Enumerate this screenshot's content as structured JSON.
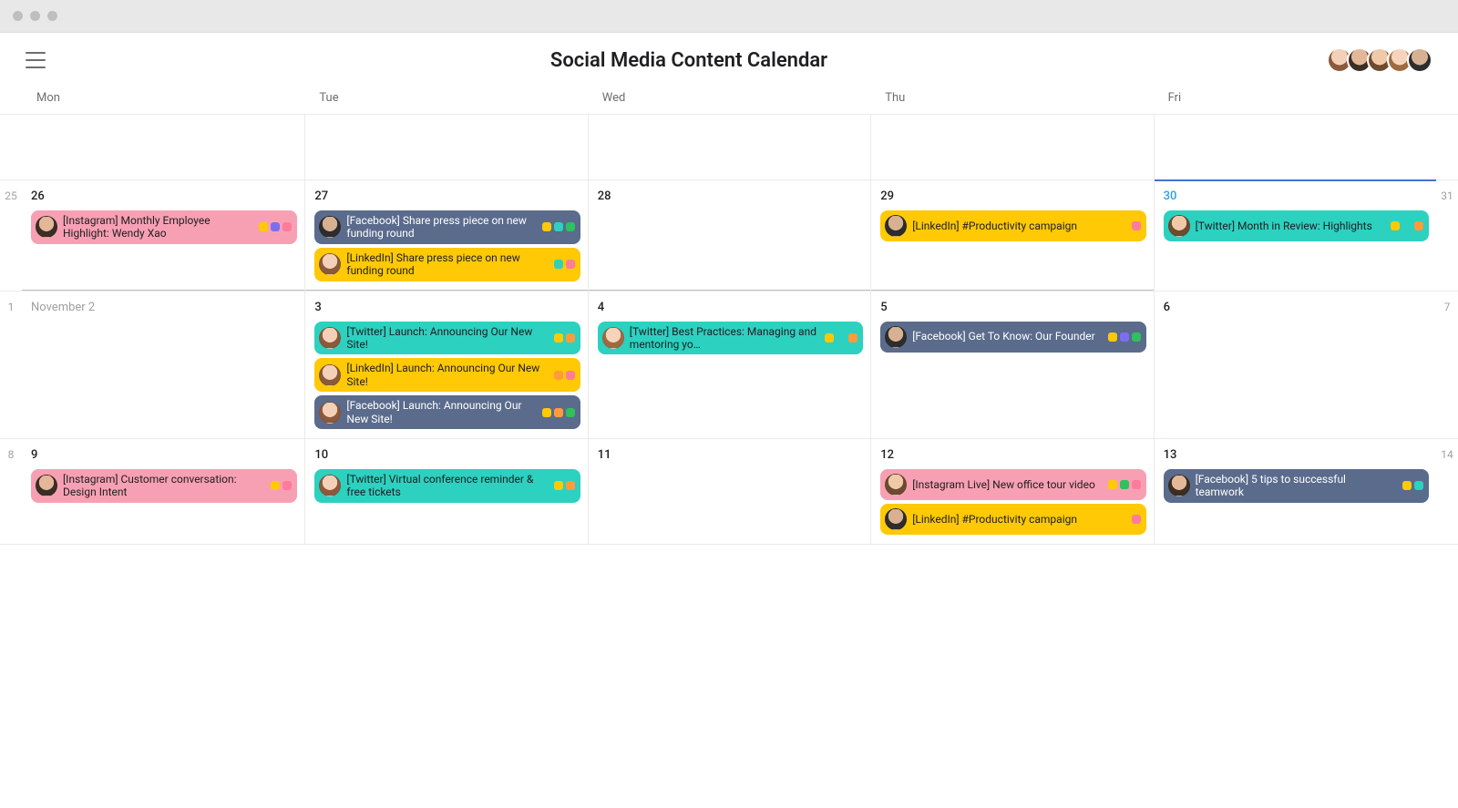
{
  "window": {
    "title": "Social Media Content Calendar"
  },
  "dow": [
    "Mon",
    "Tue",
    "Wed",
    "Thu",
    "Fri"
  ],
  "header_avatars": [
    "pA",
    "pB",
    "pC",
    "pD",
    "pE"
  ],
  "colors": {
    "event": {
      "pink": "#f8a0b3",
      "slate": "#5a6b8c",
      "yellow": "#ffc905",
      "teal": "#2cd1c0"
    },
    "tag": {
      "yellow": "#ffc905",
      "purple": "#7a6ff0",
      "pink": "#ff7b9d",
      "teal": "#2cd1c0",
      "green": "#2ec15d",
      "orange": "#ff9a3d",
      "blue": "#4aa3ff"
    }
  },
  "weeks": [
    {
      "left_gutter": "",
      "right_gutter": "",
      "stub": true,
      "cells": [
        {
          "label": "",
          "events": []
        },
        {
          "label": "",
          "events": []
        },
        {
          "label": "",
          "events": []
        },
        {
          "label": "",
          "events": []
        },
        {
          "label": "",
          "events": []
        }
      ]
    },
    {
      "left_gutter": "25",
      "right_gutter": "31",
      "cells": [
        {
          "label": "26",
          "month_edge": true,
          "events": [
            {
              "color": "pink",
              "avatar": "pB",
              "text": "[Instagram] Monthly Employee Highlight: Wendy Xao",
              "tags": [
                "yellow",
                "purple",
                "pink"
              ]
            }
          ]
        },
        {
          "label": "27",
          "month_edge": true,
          "events": [
            {
              "color": "slate",
              "avatar": "pE",
              "text": "[Facebook] Share press piece on new funding round",
              "tags": [
                "yellow",
                "teal",
                "green"
              ],
              "dark": true
            },
            {
              "color": "yellow",
              "avatar": "pA",
              "text": "[LinkedIn] Share press piece on new funding round",
              "tags": [
                "teal",
                "pink"
              ]
            }
          ]
        },
        {
          "label": "28",
          "month_edge": true,
          "events": []
        },
        {
          "label": "29",
          "month_edge": true,
          "events": [
            {
              "color": "yellow",
              "avatar": "pE",
              "text": "[LinkedIn] #Productivity campaign",
              "tags": [
                "pink"
              ]
            }
          ]
        },
        {
          "label": "30",
          "today": true,
          "events": [
            {
              "color": "teal",
              "avatar": "pC",
              "text": "[Twitter] Month in Review: Highlights",
              "tags": [
                "yellow",
                "teal",
                "orange"
              ]
            }
          ]
        }
      ]
    },
    {
      "left_gutter": "1",
      "right_gutter": "7",
      "cells": [
        {
          "label": "November 2",
          "muted": true,
          "events": []
        },
        {
          "label": "3",
          "events": [
            {
              "color": "teal",
              "avatar": "pA",
              "text": "[Twitter] Launch: Announcing Our New Site!",
              "tags": [
                "yellow",
                "orange"
              ]
            },
            {
              "color": "yellow",
              "avatar": "pA",
              "text": "[LinkedIn] Launch: Announcing Our New Site!",
              "tags": [
                "orange",
                "pink"
              ]
            },
            {
              "color": "slate",
              "avatar": "pA",
              "text": "[Facebook] Launch: Announcing Our New Site!",
              "tags": [
                "yellow",
                "orange",
                "green"
              ],
              "dark": true
            }
          ]
        },
        {
          "label": "4",
          "events": [
            {
              "color": "teal",
              "avatar": "pD",
              "text": "[Twitter] Best Practices: Managing and mentoring yo…",
              "tags": [
                "yellow",
                "teal",
                "orange"
              ]
            }
          ]
        },
        {
          "label": "5",
          "events": [
            {
              "color": "slate",
              "avatar": "pE",
              "text": "[Facebook] Get To Know: Our Founder",
              "tags": [
                "yellow",
                "purple",
                "green"
              ],
              "dark": true
            }
          ]
        },
        {
          "label": "6",
          "events": []
        }
      ]
    },
    {
      "left_gutter": "8",
      "right_gutter": "14",
      "cells": [
        {
          "label": "9",
          "events": [
            {
              "color": "pink",
              "avatar": "pB",
              "text": "[Instagram] Customer conversation: Design Intent",
              "tags": [
                "yellow",
                "pink"
              ]
            }
          ]
        },
        {
          "label": "10",
          "events": [
            {
              "color": "teal",
              "avatar": "pA",
              "text": "[Twitter] Virtual conference reminder & free tickets",
              "tags": [
                "yellow",
                "orange"
              ]
            }
          ]
        },
        {
          "label": "11",
          "events": []
        },
        {
          "label": "12",
          "events": [
            {
              "color": "pink",
              "avatar": "pC",
              "text": "[Instagram Live] New office tour video",
              "tags": [
                "yellow",
                "green",
                "pink"
              ]
            },
            {
              "color": "yellow",
              "avatar": "pE",
              "text": "[LinkedIn] #Productivity campaign",
              "tags": [
                "pink"
              ]
            }
          ]
        },
        {
          "label": "13",
          "events": [
            {
              "color": "slate",
              "avatar": "pB",
              "text": "[Facebook] 5 tips to successful teamwork",
              "tags": [
                "yellow",
                "teal"
              ],
              "dark": true
            }
          ]
        }
      ]
    }
  ]
}
